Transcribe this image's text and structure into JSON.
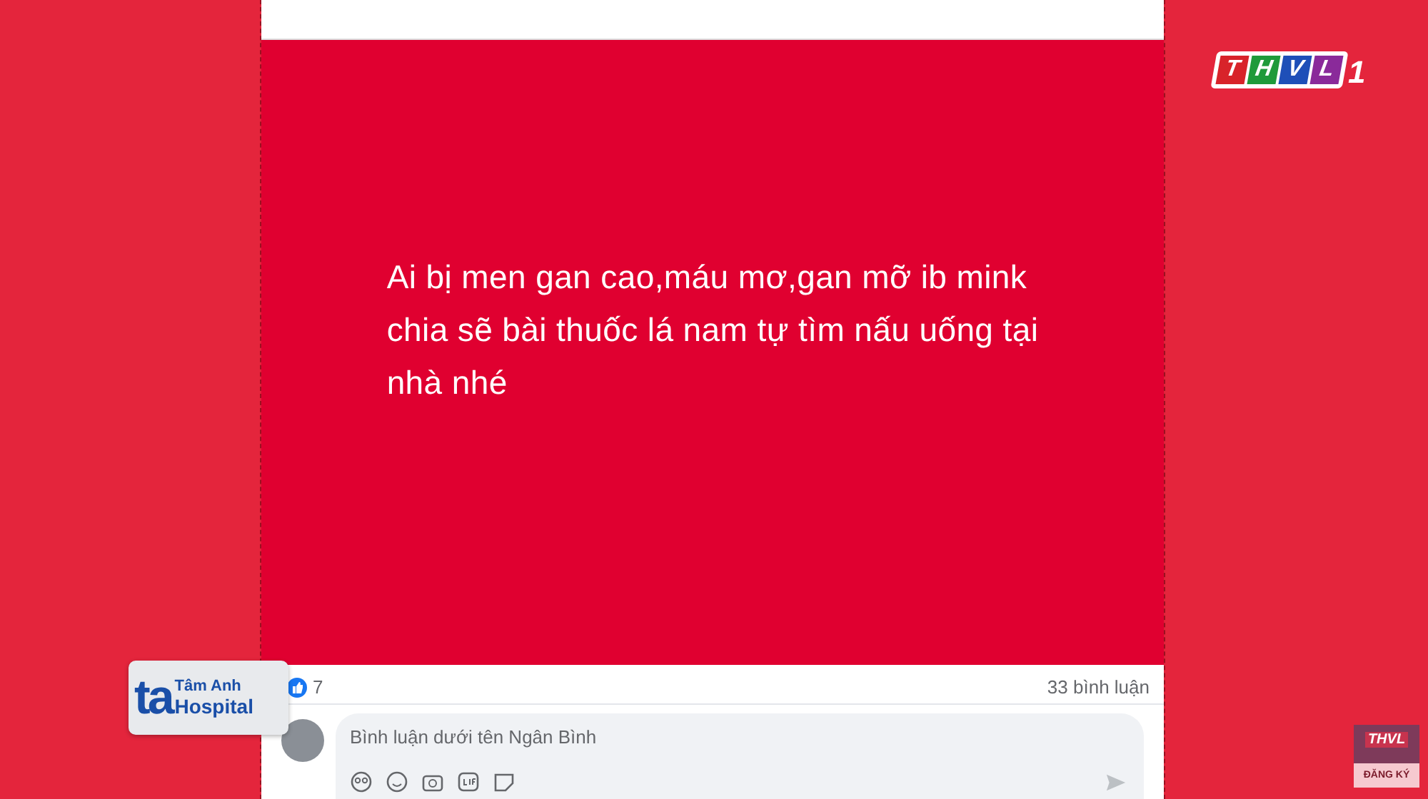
{
  "channel_logo": {
    "letters": [
      {
        "text": "T",
        "color": "#d8232a"
      },
      {
        "text": "H",
        "color": "#1f9a3a"
      },
      {
        "text": "V",
        "color": "#1e4fb8"
      },
      {
        "text": "L",
        "color": "#8a2a9a"
      }
    ],
    "number": "1"
  },
  "post": {
    "lines": [
      "Ai bị men gan cao,máu mơ,gan mỡ ib mink",
      "chia sẽ bài thuốc lá nam tự tìm nấu uống tại",
      "nhà nhé"
    ],
    "reactions": "7",
    "comments": "33 bình luận",
    "comment_field": {
      "placeholder": "Bình luận dưới tên Ngân Bình"
    }
  },
  "sponsor_logo": {
    "mark": "ta",
    "name": "Tâm Anh",
    "subtitle": "Hospital"
  },
  "subscribe_badge": {
    "logo": "THVL",
    "label": "ĐĂNG KÝ"
  }
}
